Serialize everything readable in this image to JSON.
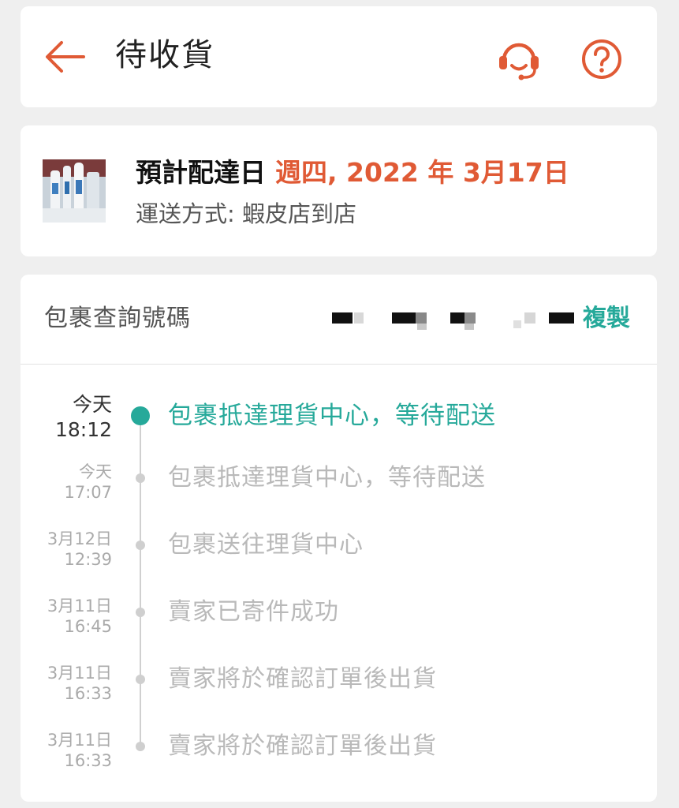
{
  "header": {
    "title": "待收貨",
    "back_icon": "arrow-left-icon",
    "support_icon": "headset-icon",
    "help_icon": "question-circle-icon",
    "accent": "#e05a35"
  },
  "delivery": {
    "estimate_label": "預計配達日",
    "estimate_date": "週四, 2022 年 3月17日",
    "shipping_method": "運送方式: 蝦皮店到店"
  },
  "tracking": {
    "label": "包裹查詢號碼",
    "copy_label": "複製",
    "accent": "#26a99a",
    "events": [
      {
        "date": "今天",
        "time": "18:12",
        "text": "包裹抵達理貨中心，等待配送",
        "status": "active"
      },
      {
        "date": "今天",
        "time": "17:07",
        "text": "包裹抵達理貨中心，等待配送",
        "status": "past"
      },
      {
        "date": "3月12日",
        "time": "12:39",
        "text": "包裹送往理貨中心",
        "status": "past"
      },
      {
        "date": "3月11日",
        "time": "16:45",
        "text": "賣家已寄件成功",
        "status": "past"
      },
      {
        "date": "3月11日",
        "time": "16:33",
        "text": "賣家將於確認訂單後出貨",
        "status": "past"
      },
      {
        "date": "3月11日",
        "time": "16:33",
        "text": "賣家將於確認訂單後出貨",
        "status": "past"
      }
    ]
  }
}
